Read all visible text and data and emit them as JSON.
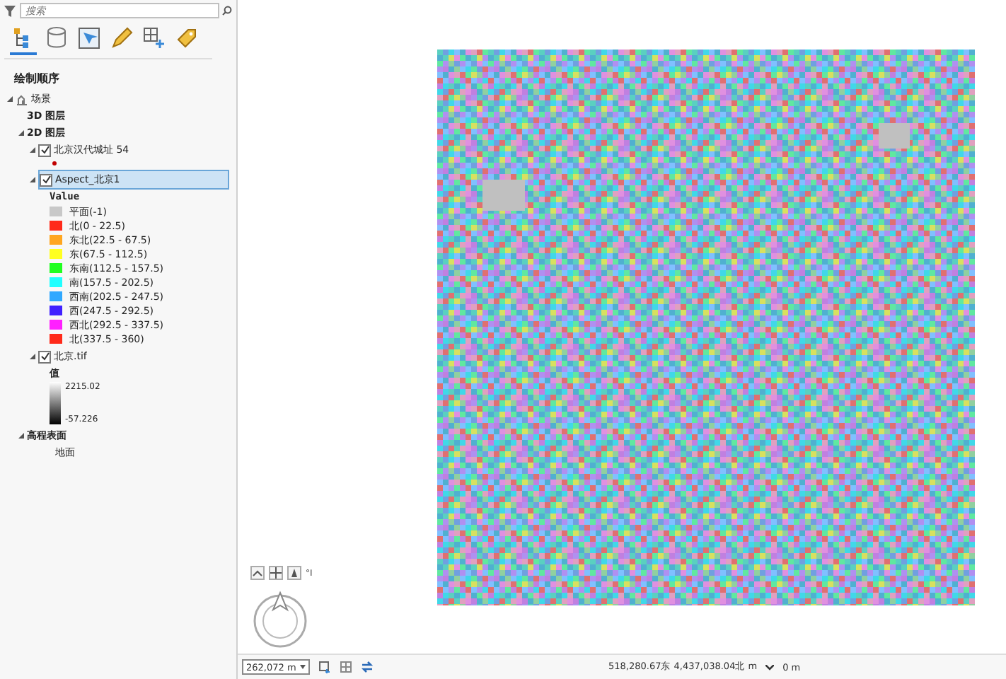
{
  "contents_pane": {
    "search": {
      "placeholder": "搜索"
    },
    "view_tabs": [
      {
        "kind": "list",
        "selected": true
      },
      {
        "kind": "source",
        "selected": false
      },
      {
        "kind": "selection",
        "selected": false
      },
      {
        "kind": "edit",
        "selected": false
      },
      {
        "kind": "snap",
        "selected": false
      },
      {
        "kind": "label",
        "selected": false
      }
    ],
    "heading": "绘制顺序",
    "tree": [
      {
        "kind": "scene",
        "label": "场景",
        "expanded": true,
        "children": [
          {
            "kind": "group",
            "label": "3D 图层"
          },
          {
            "kind": "group",
            "label": "2D 图层",
            "expanded": true,
            "children": [
              {
                "kind": "layer",
                "label": "北京汉代城址 54",
                "checked": true,
                "expanded": true,
                "selected": false,
                "legend": {
                  "kind": "point",
                  "color": "#c00000"
                }
              },
              {
                "kind": "layer",
                "label": "Aspect_北京1",
                "checked": true,
                "expanded": true,
                "selected": true,
                "legend": {
                  "kind": "classes",
                  "title": "Value",
                  "classes": [
                    {
                      "label": "平面(-1)",
                      "color": "#c8c8c8"
                    },
                    {
                      "label": "北(0 - 22.5)",
                      "color": "#ff2a1a"
                    },
                    {
                      "label": "东北(22.5 - 67.5)",
                      "color": "#ffa620"
                    },
                    {
                      "label": "东(67.5 - 112.5)",
                      "color": "#ffff20"
                    },
                    {
                      "label": "东南(112.5 - 157.5)",
                      "color": "#20ff20"
                    },
                    {
                      "label": "南(157.5 - 202.5)",
                      "color": "#20ffff"
                    },
                    {
                      "label": "西南(202.5 - 247.5)",
                      "color": "#30a8ff"
                    },
                    {
                      "label": "西(247.5 - 292.5)",
                      "color": "#4020ff"
                    },
                    {
                      "label": "西北(292.5 - 337.5)",
                      "color": "#ff20ff"
                    },
                    {
                      "label": "北(337.5 - 360)",
                      "color": "#ff2a1a"
                    }
                  ]
                }
              },
              {
                "kind": "layer",
                "label": "北京.tif",
                "checked": true,
                "expanded": true,
                "selected": false,
                "legend": {
                  "kind": "ramp",
                  "title": "值",
                  "high": "2215.02",
                  "low": "-57.226"
                }
              }
            ]
          },
          {
            "kind": "group",
            "label": "高程表面",
            "expanded": true,
            "children": [
              {
                "kind": "item",
                "label": "地面"
              }
            ]
          }
        ]
      }
    ]
  },
  "navigator": {
    "label": "°I"
  },
  "status_bar": {
    "scale": "262,072 m",
    "coordinates": "518,280.67东 4,437,038.04北 m",
    "elevation": "0 m"
  }
}
